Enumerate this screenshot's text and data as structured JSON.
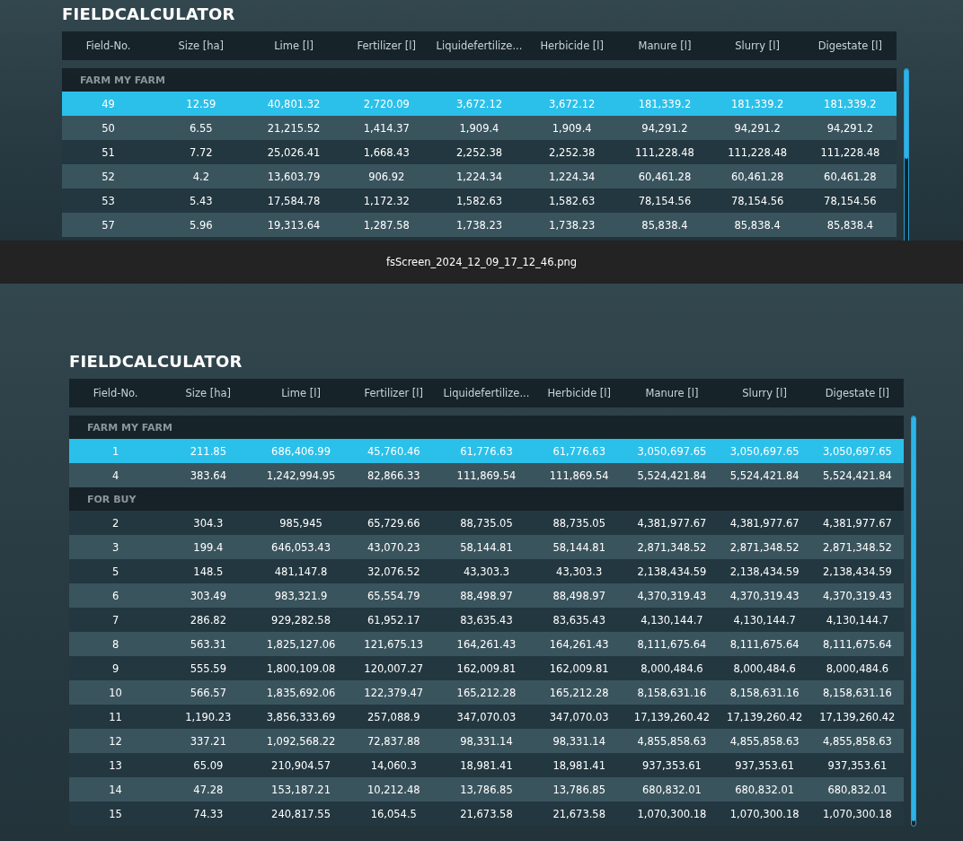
{
  "screens": [
    {
      "title": "FIELDCALCULATOR",
      "columns": [
        "Field-No.",
        "Size [ha]",
        "Lime [l]",
        "Fertilizer [l]",
        "Liquidefertilize...",
        "Herbicide [l]",
        "Manure [l]",
        "Slurry [l]",
        "Digestate [l]"
      ],
      "groups": [
        {
          "label": "FARM MY FARM",
          "rows": [
            {
              "selected": true,
              "cells": [
                "49",
                "12.59",
                "40,801.32",
                "2,720.09",
                "3,672.12",
                "3,672.12",
                "181,339.2",
                "181,339.2",
                "181,339.2"
              ]
            },
            {
              "selected": false,
              "cells": [
                "50",
                "6.55",
                "21,215.52",
                "1,414.37",
                "1,909.4",
                "1,909.4",
                "94,291.2",
                "94,291.2",
                "94,291.2"
              ]
            },
            {
              "selected": false,
              "cells": [
                "51",
                "7.72",
                "25,026.41",
                "1,668.43",
                "2,252.38",
                "2,252.38",
                "111,228.48",
                "111,228.48",
                "111,228.48"
              ]
            },
            {
              "selected": false,
              "cells": [
                "52",
                "4.2",
                "13,603.79",
                "906.92",
                "1,224.34",
                "1,224.34",
                "60,461.28",
                "60,461.28",
                "60,461.28"
              ]
            },
            {
              "selected": false,
              "cells": [
                "53",
                "5.43",
                "17,584.78",
                "1,172.32",
                "1,582.63",
                "1,582.63",
                "78,154.56",
                "78,154.56",
                "78,154.56"
              ]
            },
            {
              "selected": false,
              "cells": [
                "57",
                "5.96",
                "19,313.64",
                "1,287.58",
                "1,738.23",
                "1,738.23",
                "85,838.4",
                "85,838.4",
                "85,838.4"
              ]
            }
          ]
        }
      ]
    },
    {
      "title": "FIELDCALCULATOR",
      "columns": [
        "Field-No.",
        "Size [ha]",
        "Lime [l]",
        "Fertilizer [l]",
        "Liquidefertilize...",
        "Herbicide [l]",
        "Manure [l]",
        "Slurry [l]",
        "Digestate [l]"
      ],
      "groups": [
        {
          "label": "FARM MY FARM",
          "rows": [
            {
              "selected": true,
              "cells": [
                "1",
                "211.85",
                "686,406.99",
                "45,760.46",
                "61,776.63",
                "61,776.63",
                "3,050,697.65",
                "3,050,697.65",
                "3,050,697.65"
              ]
            },
            {
              "selected": false,
              "cells": [
                "4",
                "383.64",
                "1,242,994.95",
                "82,866.33",
                "111,869.54",
                "111,869.54",
                "5,524,421.84",
                "5,524,421.84",
                "5,524,421.84"
              ]
            }
          ]
        },
        {
          "label": "FOR BUY",
          "rows": [
            {
              "selected": false,
              "cells": [
                "2",
                "304.3",
                "985,945",
                "65,729.66",
                "88,735.05",
                "88,735.05",
                "4,381,977.67",
                "4,381,977.67",
                "4,381,977.67"
              ]
            },
            {
              "selected": false,
              "cells": [
                "3",
                "199.4",
                "646,053.43",
                "43,070.23",
                "58,144.81",
                "58,144.81",
                "2,871,348.52",
                "2,871,348.52",
                "2,871,348.52"
              ]
            },
            {
              "selected": false,
              "cells": [
                "5",
                "148.5",
                "481,147.8",
                "32,076.52",
                "43,303.3",
                "43,303.3",
                "2,138,434.59",
                "2,138,434.59",
                "2,138,434.59"
              ]
            },
            {
              "selected": false,
              "cells": [
                "6",
                "303.49",
                "983,321.9",
                "65,554.79",
                "88,498.97",
                "88,498.97",
                "4,370,319.43",
                "4,370,319.43",
                "4,370,319.43"
              ]
            },
            {
              "selected": false,
              "cells": [
                "7",
                "286.82",
                "929,282.58",
                "61,952.17",
                "83,635.43",
                "83,635.43",
                "4,130,144.7",
                "4,130,144.7",
                "4,130,144.7"
              ]
            },
            {
              "selected": false,
              "cells": [
                "8",
                "563.31",
                "1,825,127.06",
                "121,675.13",
                "164,261.43",
                "164,261.43",
                "8,111,675.64",
                "8,111,675.64",
                "8,111,675.64"
              ]
            },
            {
              "selected": false,
              "cells": [
                "9",
                "555.59",
                "1,800,109.08",
                "120,007.27",
                "162,009.81",
                "162,009.81",
                "8,000,484.6",
                "8,000,484.6",
                "8,000,484.6"
              ]
            },
            {
              "selected": false,
              "cells": [
                "10",
                "566.57",
                "1,835,692.06",
                "122,379.47",
                "165,212.28",
                "165,212.28",
                "8,158,631.16",
                "8,158,631.16",
                "8,158,631.16"
              ]
            },
            {
              "selected": false,
              "cells": [
                "11",
                "1,190.23",
                "3,856,333.69",
                "257,088.9",
                "347,070.03",
                "347,070.03",
                "17,139,260.42",
                "17,139,260.42",
                "17,139,260.42"
              ]
            },
            {
              "selected": false,
              "cells": [
                "12",
                "337.21",
                "1,092,568.22",
                "72,837.88",
                "98,331.14",
                "98,331.14",
                "4,855,858.63",
                "4,855,858.63",
                "4,855,858.63"
              ]
            },
            {
              "selected": false,
              "cells": [
                "13",
                "65.09",
                "210,904.57",
                "14,060.3",
                "18,981.41",
                "18,981.41",
                "937,353.61",
                "937,353.61",
                "937,353.61"
              ]
            },
            {
              "selected": false,
              "cells": [
                "14",
                "47.28",
                "153,187.21",
                "10,212.48",
                "13,786.85",
                "13,786.85",
                "680,832.01",
                "680,832.01",
                "680,832.01"
              ]
            },
            {
              "selected": false,
              "cells": [
                "15",
                "74.33",
                "240,817.55",
                "16,054.5",
                "21,673.58",
                "21,673.58",
                "1,070,300.18",
                "1,070,300.18",
                "1,070,300.18"
              ]
            }
          ]
        }
      ]
    }
  ],
  "caption": "fsScreen_2024_12_09_17_12_46.png"
}
